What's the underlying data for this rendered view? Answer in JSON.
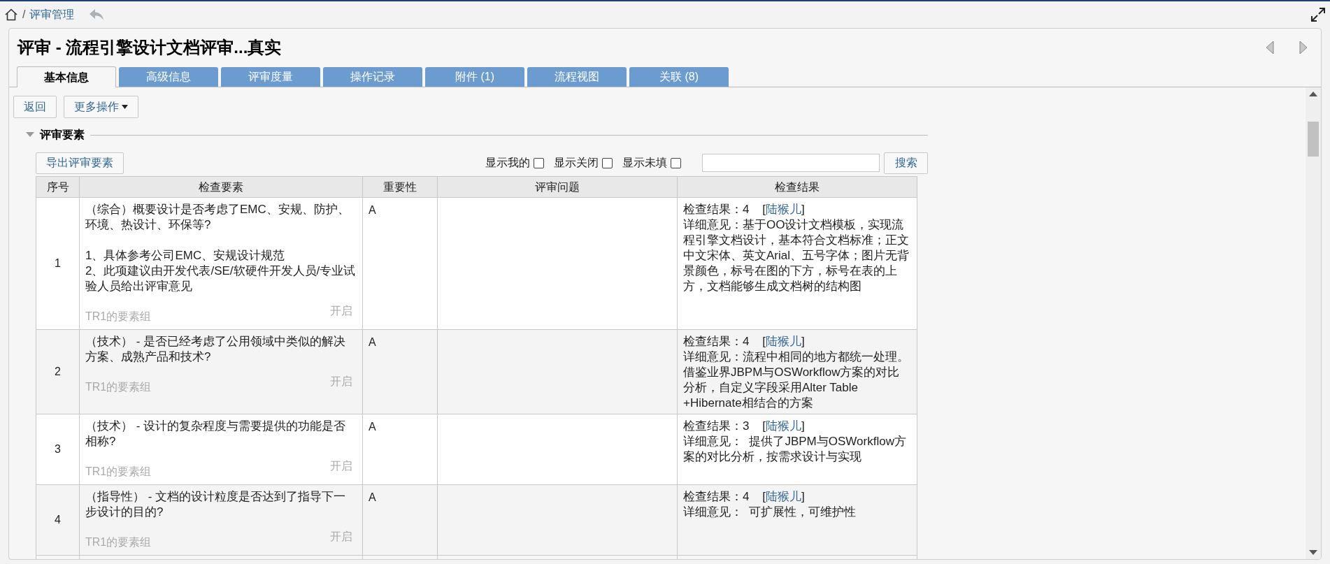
{
  "breadcrumb": {
    "separator": "/",
    "link": "评审管理"
  },
  "title": "评审 - 流程引擎设计文档评审...真实",
  "tabs": [
    {
      "label": "基本信息",
      "selected": true
    },
    {
      "label": "高级信息",
      "selected": false
    },
    {
      "label": "评审度量",
      "selected": false
    },
    {
      "label": "操作记录",
      "selected": false
    },
    {
      "label": "附件 (1)",
      "selected": false
    },
    {
      "label": "流程视图",
      "selected": false
    },
    {
      "label": "关联 (8)",
      "selected": false
    }
  ],
  "actions": [
    {
      "label": "返回",
      "kind": "plain"
    },
    {
      "label": "更多操作",
      "kind": "dropdown"
    }
  ],
  "section": {
    "title": "评审要素",
    "expanded": true
  },
  "export_button": "导出评审要素",
  "filters": [
    {
      "label": "显示我的",
      "checked": false
    },
    {
      "label": "显示关闭",
      "checked": false
    },
    {
      "label": "显示未填",
      "checked": false
    }
  ],
  "search_button": "搜索",
  "table": {
    "columns": [
      "序号",
      "检查要素",
      "重要性",
      "评审问题",
      "检查结果"
    ],
    "rows": [
      {
        "no": "1",
        "item": "（综合）概要设计是否考虑了EMC、安规、防护、环境、热设计、环保等?\n\n1、具体参考公司EMC、安规设计规范\n2、此项建议由开发代表/SE/软硬件开发人员/专业试验人员给出评审意见",
        "group": "TR1的要素组",
        "status": "开启",
        "importance": "A",
        "prefix": "检查结果：4    [",
        "reviewer": "陆猴儿",
        "suffix": "]",
        "detail": "详细意见：基于OO设计文档模板，实现流程引擎文档设计，基本符合文档标准；正文中文宋体、英文Arial、五号字体；图片无背景颜色，标号在图的下方，标号在表的上方，文档能够生成文档树的结构图"
      },
      {
        "no": "2",
        "item": "（技术） - 是否已经考虑了公用领域中类似的解决方案、成熟产品和技术?",
        "group": "TR1的要素组",
        "status": "开启",
        "importance": "A",
        "prefix": "检查结果：4    [",
        "reviewer": "陆猴儿",
        "suffix": "]",
        "detail": "详细意见：流程中相同的地方都统一处理。借鉴业界JBPM与OSWorkflow方案的对比分析，自定义字段采用Alter Table +Hibernate相结合的方案"
      },
      {
        "no": "3",
        "item": "（技术） - 设计的复杂程度与需要提供的功能是否相称?",
        "group": "TR1的要素组",
        "status": "开启",
        "importance": "A",
        "prefix": "检查结果：3    [",
        "reviewer": "陆猴儿",
        "suffix": "]",
        "detail": "详细意见：  提供了JBPM与OSWorkflow方案的对比分析，按需求设计与实现"
      },
      {
        "no": "4",
        "item": "（指导性） - 文档的设计粒度是否达到了指导下一步设计的目的?",
        "group": "TR1的要素组",
        "status": "开启",
        "importance": "A",
        "prefix": "检查结果：4    [",
        "reviewer": "陆猴儿",
        "suffix": "]",
        "detail": "详细意见：  可扩展性，可维护性"
      }
    ]
  }
}
